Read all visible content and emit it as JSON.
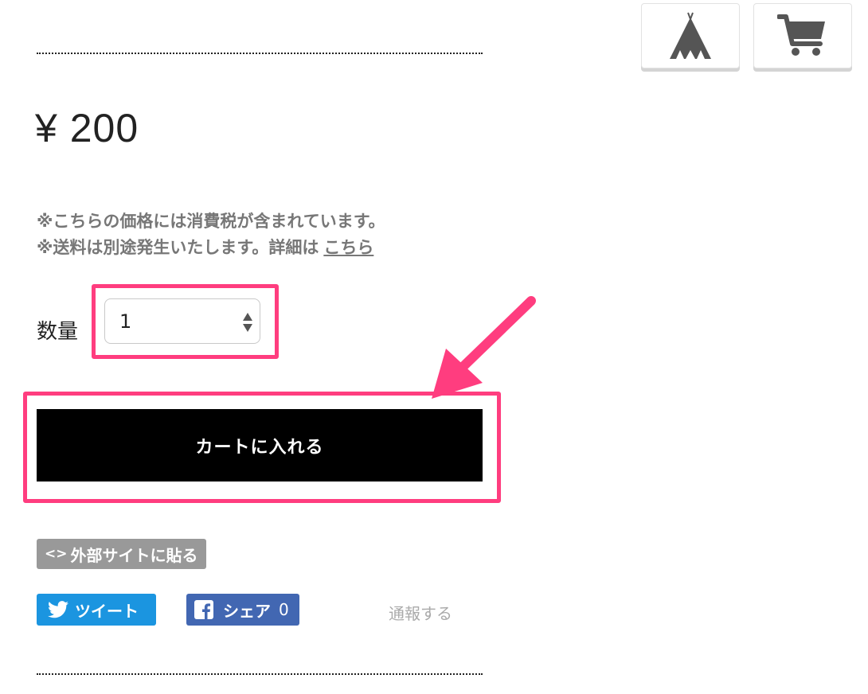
{
  "header": {
    "tent_icon": "tent-icon",
    "cart_icon": "cart-icon"
  },
  "product": {
    "price": "¥ 200",
    "tax_note": "※こちらの価格には消費税が含まれています。",
    "shipping_note": "※送料は別途発生いたします。詳細は",
    "shipping_link": "こちら"
  },
  "quantity": {
    "label": "数量",
    "value": "1"
  },
  "cart_button": {
    "label": "カートに入れる"
  },
  "embed": {
    "code_glyph": "<>",
    "label": "外部サイトに貼る"
  },
  "social": {
    "tweet_label": "ツイート",
    "share_label": "シェア",
    "share_count": "0",
    "report_label": "通報する"
  },
  "colors": {
    "highlight": "#ff3d7f",
    "tweet": "#1b95e0",
    "facebook": "#4267b2"
  }
}
